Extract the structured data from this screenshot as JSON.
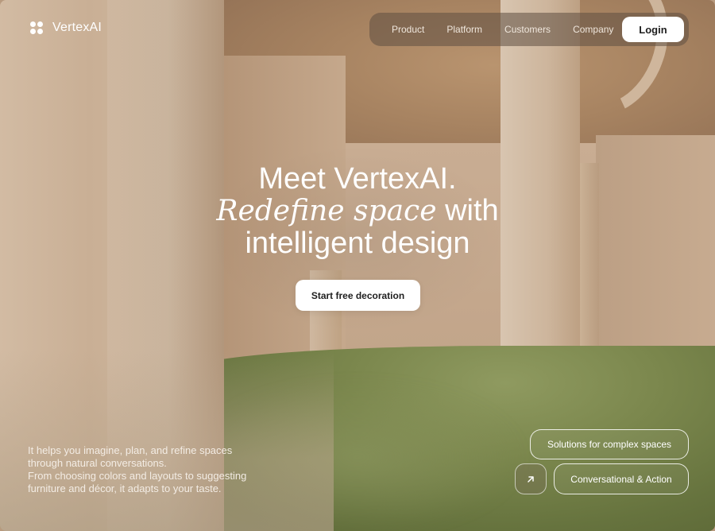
{
  "brand": {
    "name": "VertexAI",
    "icon": "four-dots-logo-icon"
  },
  "nav": {
    "items": [
      "Product",
      "Platform",
      "Customers",
      "Company"
    ],
    "login_label": "Login"
  },
  "hero": {
    "line1": "Meet VertexAI.",
    "line2_serif": "Redefine space",
    "line2_rest": "with",
    "line3": "intelligent design",
    "cta_label": "Start free decoration"
  },
  "description": {
    "line1": "It helps you imagine, plan, and refine spaces",
    "line2": "through natural conversations.",
    "line3": "From choosing colors and layouts to suggesting",
    "line4": "furniture and décor, it adapts to your taste."
  },
  "pills": {
    "solutions_label": "Solutions for complex spaces",
    "conversational_label": "Conversational & Action",
    "arrow_icon": "arrow-up-right-icon"
  },
  "colors": {
    "nav_bg": "#5f4e42",
    "button_bg": "#ffffff",
    "text_on_image": "#ffffff"
  }
}
